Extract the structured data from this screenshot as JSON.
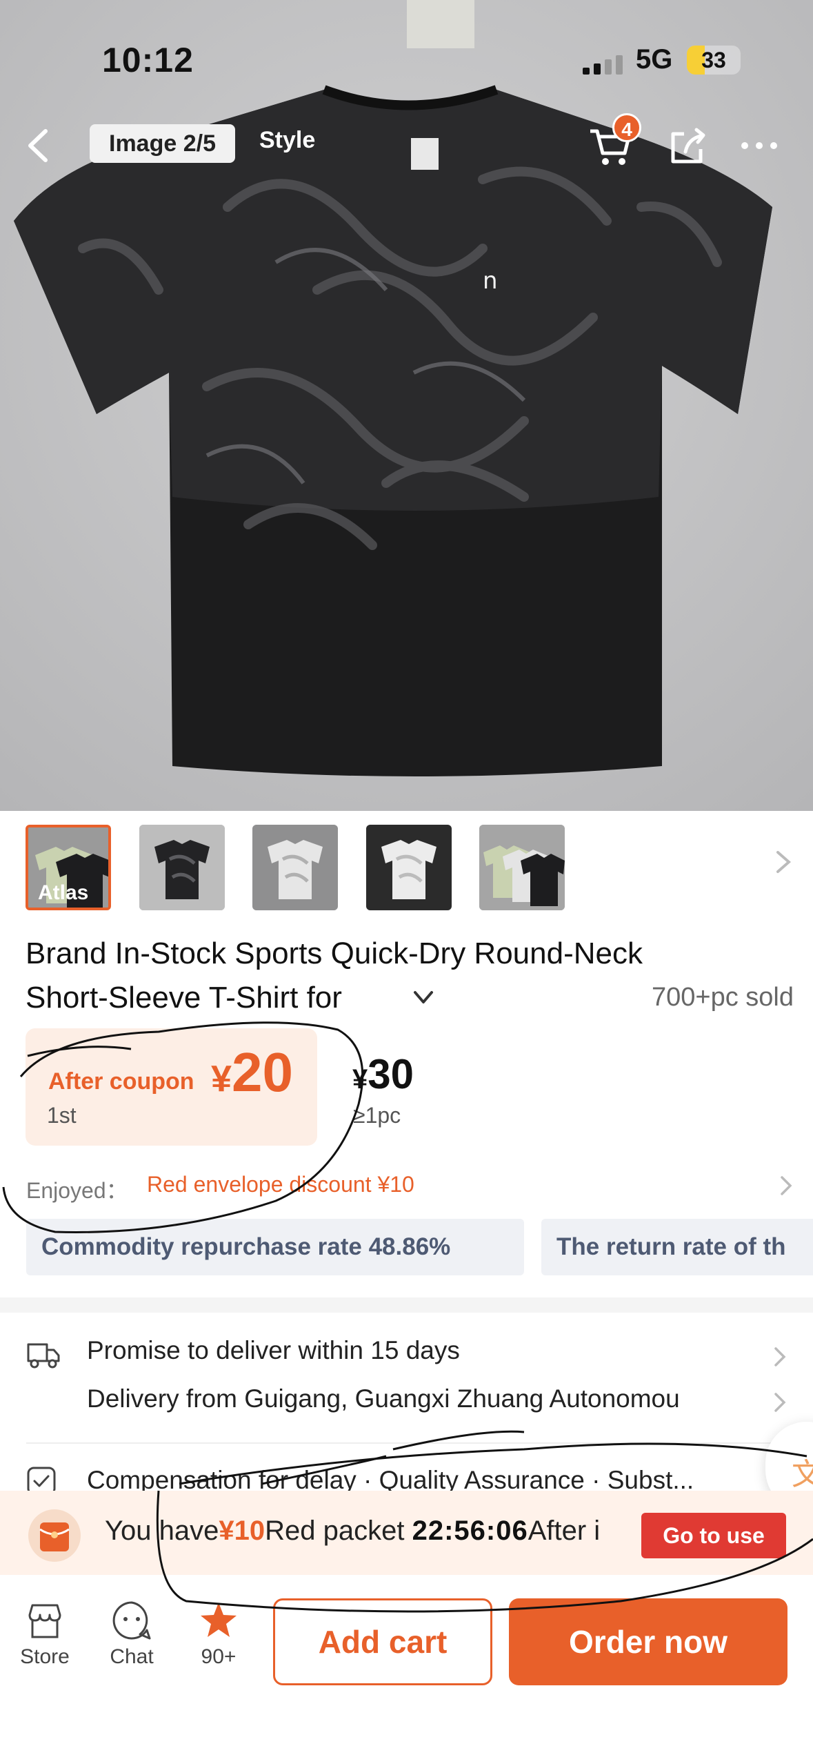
{
  "status_bar": {
    "time": "10:12",
    "network": "5G",
    "battery": "33",
    "battery_level": 0.33
  },
  "nav": {
    "image_indicator": "Image 2/5",
    "style_tab": "Style",
    "cart_badge": "4",
    "icons": [
      "back-arrow-icon",
      "cart-icon",
      "share-icon",
      "more-icon"
    ]
  },
  "thumbnails": [
    {
      "label": "Atlas",
      "active": true
    },
    {
      "label": "",
      "active": false
    },
    {
      "label": "",
      "active": false
    },
    {
      "label": "",
      "active": false
    },
    {
      "label": "",
      "active": false
    }
  ],
  "product": {
    "title_line1": "Brand In-Stock Sports Quick-Dry Round-Neck",
    "title_line2": "Short-Sleeve T-Shirt for",
    "sold": "700+pc sold"
  },
  "pricing": {
    "coupon_label": "After coupon",
    "coupon_currency": "¥",
    "coupon_price": "20",
    "coupon_tier": "1st",
    "list_currency": "¥",
    "list_price": "30",
    "list_tier": "≥1pc",
    "enjoyed_label": "Enjoyed：",
    "enjoyed_value": "Red envelope discount ¥10"
  },
  "tags": [
    "Commodity repurchase rate 48.86%",
    "The return rate of th"
  ],
  "delivery": {
    "promise": "Promise to deliver within 15 days",
    "origin": "Delivery from Guigang, Guangxi Zhuang Autonomou",
    "assurance": "Compensation for delay · Quality Assurance · Subst..."
  },
  "red_packet": {
    "prefix": "You have",
    "amount": "¥10",
    "label": "Red packet",
    "timer": "22:56:06",
    "suffix": "After i",
    "button": "Go to use"
  },
  "bottom_bar": {
    "store": "Store",
    "chat": "Chat",
    "favorites": "90+",
    "add_cart": "Add cart",
    "order_now": "Order now"
  },
  "colors": {
    "accent": "#e8602a",
    "go_use": "#e03a33",
    "tag_text": "#4e5a73"
  }
}
